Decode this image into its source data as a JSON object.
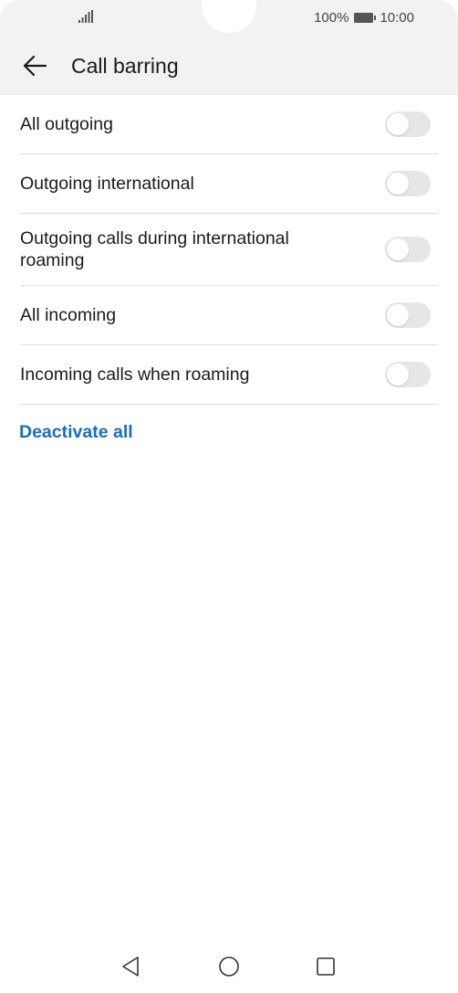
{
  "status_bar": {
    "battery_text": "100%",
    "time": "10:00"
  },
  "header": {
    "title": "Call barring"
  },
  "items": [
    {
      "label": "All outgoing",
      "enabled": false
    },
    {
      "label": "Outgoing international",
      "enabled": false
    },
    {
      "label": "Outgoing calls during international roaming",
      "enabled": false
    },
    {
      "label": "All incoming",
      "enabled": false
    },
    {
      "label": "Incoming calls when roaming",
      "enabled": false
    }
  ],
  "actions": {
    "deactivate_all": "Deactivate all"
  },
  "colors": {
    "accent": "#1c6dbf",
    "header_bg": "#f2f2f2",
    "toggle_off": "#e6e6e6",
    "divider": "#dedede"
  },
  "icons": {
    "back": "arrow-left-icon",
    "signal": "signal-icon",
    "battery": "battery-icon",
    "nav_back": "triangle-back-icon",
    "nav_home": "circle-home-icon",
    "nav_recent": "square-recent-icon"
  }
}
